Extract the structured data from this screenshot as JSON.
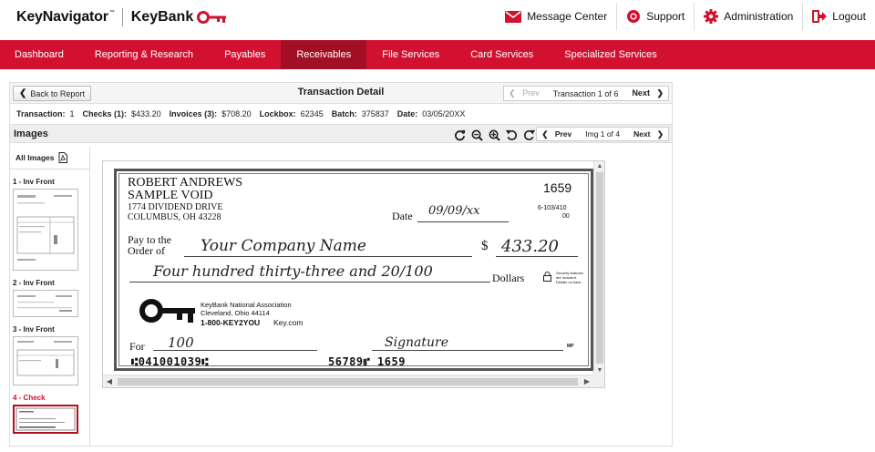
{
  "header": {
    "brand_name": "KeyNavigator",
    "brand_tm": "™",
    "bank_name": "KeyBank",
    "links": [
      "Message Center",
      "Support",
      "Administration",
      "Logout"
    ]
  },
  "nav": {
    "items": [
      "Dashboard",
      "Reporting & Research",
      "Payables",
      "Receivables",
      "File Services",
      "Card Services",
      "Specialized Services"
    ],
    "active": "Receivables"
  },
  "titlebar": {
    "back_label": "Back to Report",
    "title": "Transaction Detail",
    "prev": "Prev",
    "position": "Transaction 1 of 6",
    "next": "Next"
  },
  "summary": {
    "transaction_label": "Transaction:",
    "transaction": "1",
    "checks_label": "Checks (1):",
    "checks": "$433.20",
    "invoices_label": "Invoices (3):",
    "invoices": "$708.20",
    "lockbox_label": "Lockbox:",
    "lockbox": "62345",
    "batch_label": "Batch:",
    "batch": "375837",
    "date_label": "Date:",
    "date": "03/05/20XX"
  },
  "images": {
    "title": "Images",
    "all_images": "All Images",
    "prev": "Prev",
    "position": "Img 1 of 4",
    "next": "Next",
    "thumbs": [
      "1 - Inv Front",
      "2 - Inv Front",
      "3 - Inv Front",
      "4 - Check"
    ]
  },
  "check": {
    "name": "ROBERT ANDREWS",
    "line2": "SAMPLE VOID",
    "address1": "1774 DIVIDEND DRIVE",
    "address2": "COLUMBUS, OH  43228",
    "number": "1659",
    "fraction": "6-103/410",
    "fraction2": "00",
    "date_label": "Date",
    "date_value": "09/09/xx",
    "pay_to_label": "Pay to the",
    "order_of_label": "Order of",
    "payee": "Your Company Name",
    "dollar_sign": "$",
    "amount": "433.20",
    "written_amount": "Four hundred thirty-three and 20/100",
    "dollars_label": "Dollars",
    "security_note": "Security features are included. Details on back.",
    "bank_name": "KeyBank National Association",
    "bank_city": "Cleveland, Ohio 44114",
    "bank_phone": "1-800-KEY2YOU",
    "bank_site": "Key.com",
    "for_label": "For",
    "memo": "100",
    "signature": "Signature",
    "mp": "MP",
    "micr_routing": "⑆041001039⑆",
    "micr_account": "56789⑈ 1659"
  },
  "colors": {
    "brand_red": "#d21130",
    "nav_active": "#a30f24"
  }
}
